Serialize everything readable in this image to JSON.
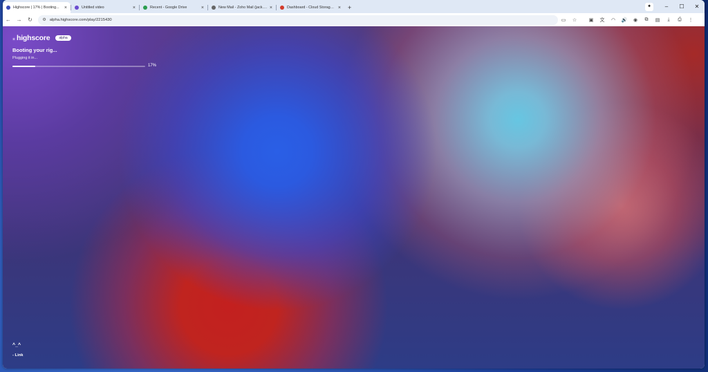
{
  "browser": {
    "tabs": [
      {
        "title": "Highscore | 17% | Booting...",
        "favicon_color": "#3b4bb8",
        "active": true
      },
      {
        "title": "Untitled video",
        "favicon_color": "#6b4ccf",
        "active": false
      },
      {
        "title": "Recent - Google Drive",
        "favicon_color": "#2a9d4f",
        "active": false
      },
      {
        "title": "New Mail - Zoho Mail (jack.dev",
        "favicon_color": "#666666",
        "active": false
      },
      {
        "title": "Dashboard - Cloud Storage — ...",
        "favicon_color": "#d23b2b",
        "active": false
      }
    ],
    "new_tab_label": "+",
    "url": "alpha.highscore.com/play/2215430",
    "window_controls": {
      "minimize": "–",
      "maximize": "☐",
      "close": "✕"
    }
  },
  "page": {
    "brand_name": "highscore",
    "brand_badge": "alpha",
    "boot_title": "Booting your rig...",
    "boot_subtitle": "Plugging it in...",
    "progress_value": 0.17,
    "progress_label": "17%",
    "footer_face": "^_^",
    "footer_link": "- Link"
  },
  "colors": {
    "accent_white": "#ffffff",
    "bg_purple": "#553a7a",
    "blob_blue": "#2a5fe6",
    "blob_cyan": "#66c6e2",
    "blob_red": "#c3201f"
  }
}
